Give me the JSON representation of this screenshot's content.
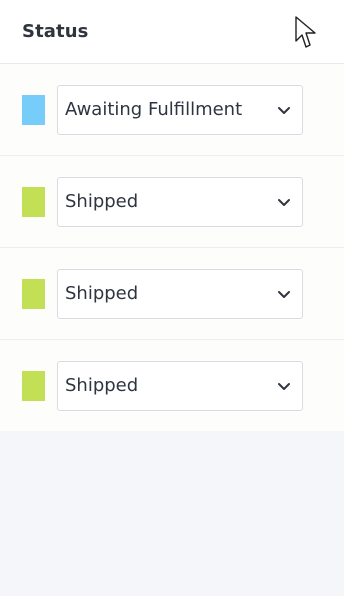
{
  "header": {
    "title": "Status"
  },
  "rows": [
    {
      "status": "Awaiting Fulfillment",
      "color": "#76cdf9"
    },
    {
      "status": "Shipped",
      "color": "#c2df56"
    },
    {
      "status": "Shipped",
      "color": "#c2df56"
    },
    {
      "status": "Shipped",
      "color": "#c2df56"
    }
  ],
  "icons": {
    "cursor": "mouse-pointer-icon",
    "dropdown": "chevron-down-icon"
  }
}
